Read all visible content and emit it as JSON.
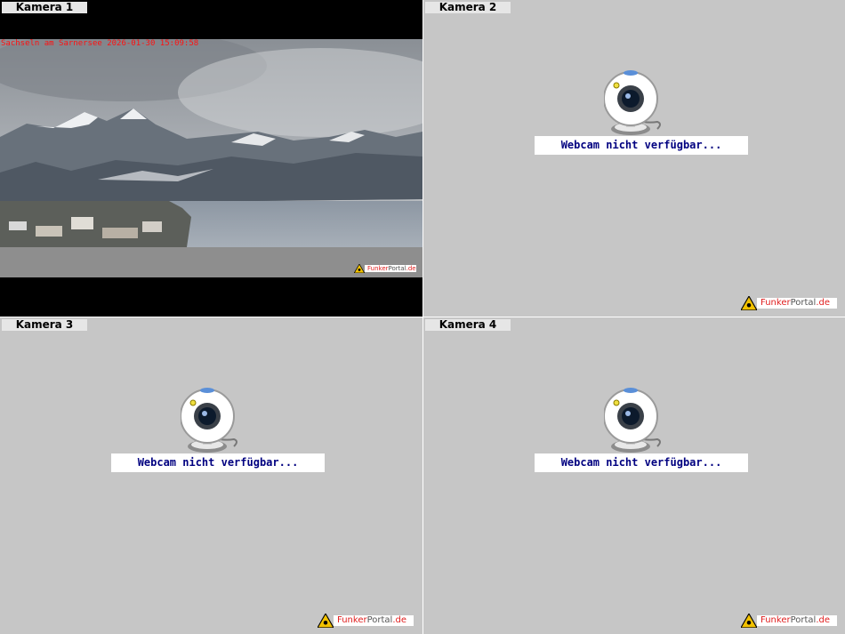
{
  "cameras": [
    {
      "label": "Kamera 1",
      "overlay_text": "Sachseln am Sarnersee 2026-01-30 15:09:58"
    },
    {
      "label": "Kamera 2",
      "status": "Webcam nicht verfügbar..."
    },
    {
      "label": "Kamera 3",
      "status": "Webcam nicht verfügbar..."
    },
    {
      "label": "Kamera 4",
      "status": "Webcam nicht verfügbar..."
    }
  ],
  "brand": {
    "part1": "Funk",
    "part2": "er",
    "part3": "Portal",
    "part4": ".de"
  },
  "icons": [
    "webcam-icon",
    "funkerportal-logo-icon"
  ],
  "colors": {
    "panel_bg": "#c6c6c6",
    "status_text": "#000080",
    "overlay_text": "#ff1010",
    "brand_red": "#e01e1e"
  }
}
